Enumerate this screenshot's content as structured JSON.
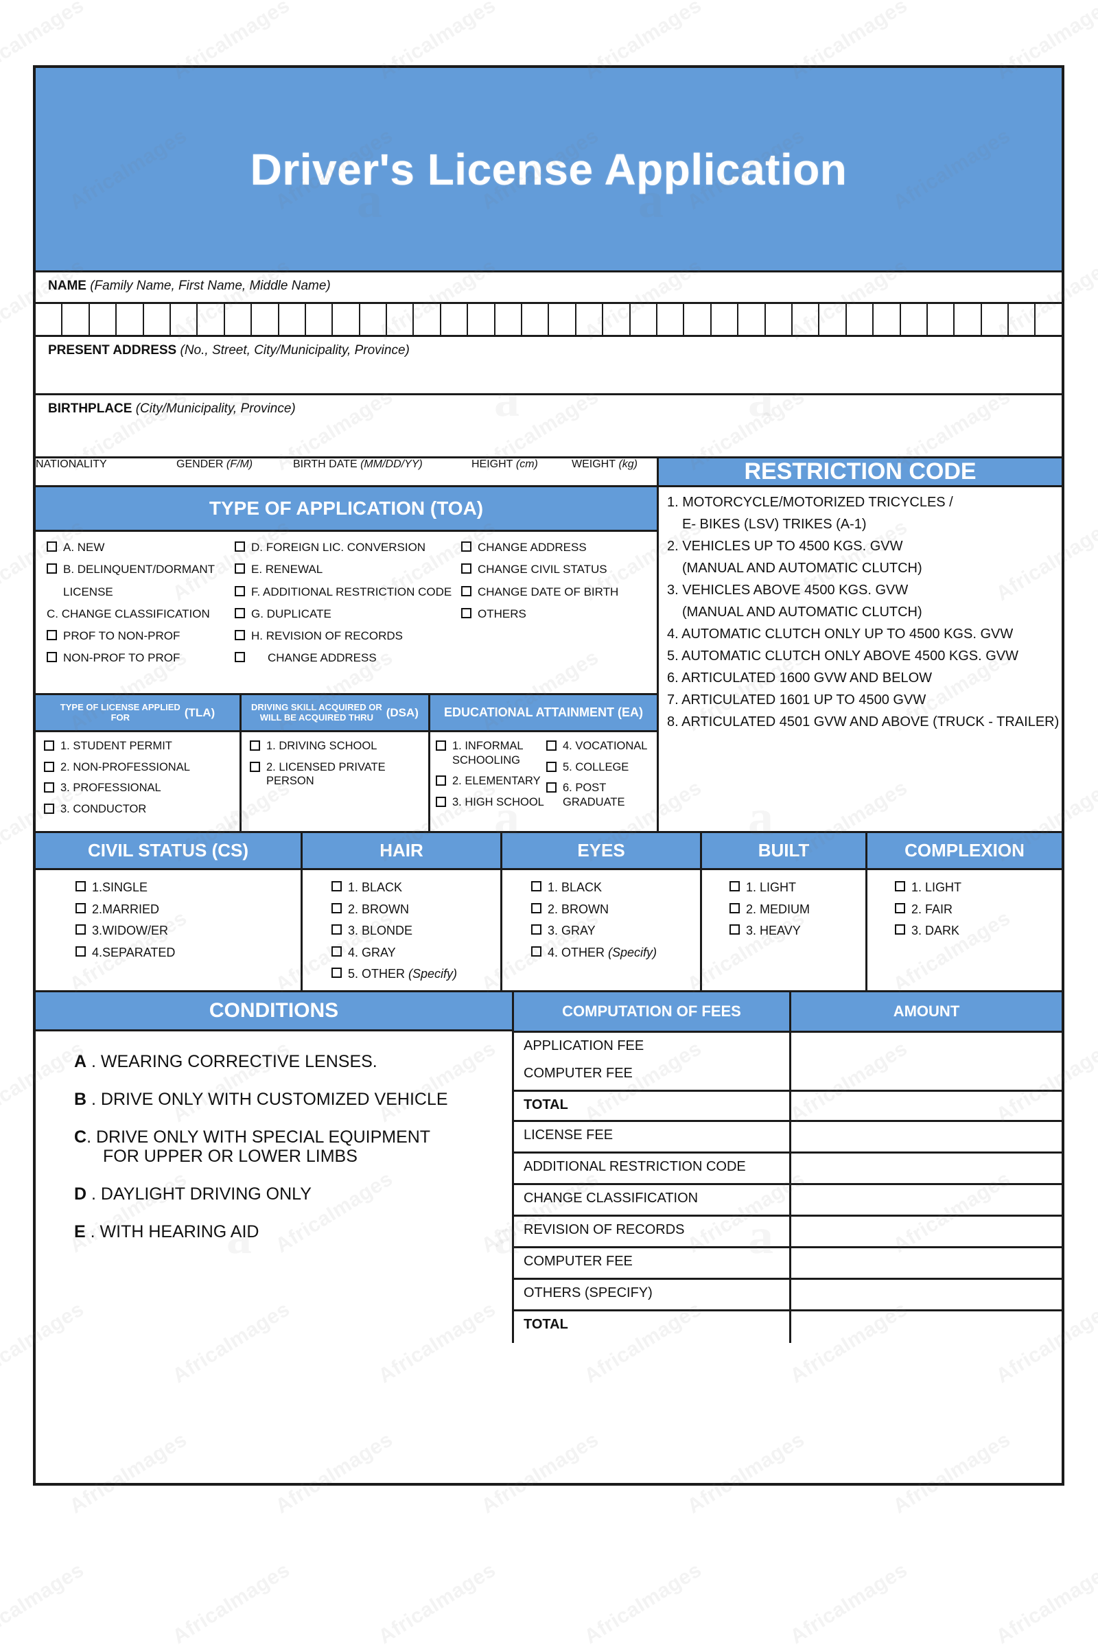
{
  "colors": {
    "accent": "#639CD9",
    "border": "#1b1b1b",
    "header_text": "#ffffff"
  },
  "header": {
    "title": "Driver's License Application"
  },
  "fields": {
    "name_label": "NAME",
    "name_hint": "(Family Name, First Name, Middle Name)",
    "name_cell_count": 38,
    "present_address_label": "PRESENT ADDRESS",
    "present_address_hint": "(No., Street, City/Municipality, Province)",
    "birthplace_label": "BIRTHPLACE",
    "birthplace_hint": "(City/Municipality, Province)"
  },
  "demographics": [
    {
      "label": "NATIONALITY",
      "hint": ""
    },
    {
      "label": "GENDER",
      "hint": "(F/M)"
    },
    {
      "label": "BIRTH DATE",
      "hint": "(MM/DD/YY)"
    },
    {
      "label": "HEIGHT",
      "hint": "(cm)"
    },
    {
      "label": "WEIGHT",
      "hint": "(kg)"
    }
  ],
  "toa": {
    "title": "TYPE OF APPLICATION (TOA)",
    "col1": [
      {
        "label": "A. NEW",
        "box": true,
        "indent": false
      },
      {
        "label": "B. DELINQUENT/DORMANT",
        "box": true,
        "indent": false
      },
      {
        "label": "LICENSE",
        "box": false,
        "indent": true
      },
      {
        "label": "C. CHANGE CLASSIFICATION",
        "box": false,
        "indent": false
      },
      {
        "label": "PROF TO NON-PROF",
        "box": true,
        "indent": false
      },
      {
        "label": "NON-PROF TO PROF",
        "box": true,
        "indent": false
      }
    ],
    "col2": [
      {
        "label": "D. FOREIGN LIC. CONVERSION",
        "box": true,
        "indent": false
      },
      {
        "label": "E. RENEWAL",
        "box": true,
        "indent": false
      },
      {
        "label": "F. ADDITIONAL RESTRICTION CODE",
        "box": true,
        "indent": false
      },
      {
        "label": "G. DUPLICATE",
        "box": true,
        "indent": false
      },
      {
        "label": "H. REVISION OF RECORDS",
        "box": true,
        "indent": false
      },
      {
        "label": "CHANGE ADDRESS",
        "box": true,
        "indent": true
      }
    ],
    "col3": [
      {
        "label": "CHANGE ADDRESS",
        "box": true,
        "indent": false
      },
      {
        "label": "CHANGE CIVIL STATUS",
        "box": true,
        "indent": false
      },
      {
        "label": "CHANGE DATE OF BIRTH",
        "box": true,
        "indent": false
      },
      {
        "label": "OTHERS",
        "box": true,
        "indent": false
      }
    ]
  },
  "tla": {
    "title_line1": "TYPE OF LICENSE APPLIED",
    "title_line2": "FOR",
    "abbr": "(TLA)",
    "options": [
      {
        "label": "1. STUDENT PERMIT"
      },
      {
        "label": "2. NON-PROFESSIONAL"
      },
      {
        "label": "3. PROFESSIONAL"
      },
      {
        "label": "3. CONDUCTOR"
      }
    ]
  },
  "dsa": {
    "title_line1": "DRIVING SKILL ACQUIRED OR",
    "title_line2": "WILL BE ACQUIRED THRU",
    "abbr": "(DSA)",
    "options": [
      {
        "label": "1. DRIVING SCHOOL"
      },
      {
        "label": "2. LICENSED PRIVATE PERSON"
      }
    ]
  },
  "ea": {
    "title": "EDUCATIONAL ATTAINMENT (EA)",
    "col1": [
      {
        "label": "1. INFORMAL SCHOOLING"
      },
      {
        "label": "2. ELEMENTARY"
      },
      {
        "label": "3. HIGH SCHOOL"
      }
    ],
    "col2": [
      {
        "label": "4. VOCATIONAL"
      },
      {
        "label": "5. COLLEGE"
      },
      {
        "label": "6. POST GRADUATE"
      }
    ]
  },
  "restriction_code": {
    "title": "RESTRICTION CODE",
    "lines": [
      {
        "text": "1. MOTORCYCLE/MOTORIZED TRICYCLES /",
        "indent": false
      },
      {
        "text": "E- BIKES (LSV) TRIKES (A-1)",
        "indent": true
      },
      {
        "text": "2.   VEHICLES UP TO 4500 KGS. GVW",
        "indent": false
      },
      {
        "text": "(MANUAL AND AUTOMATIC CLUTCH)",
        "indent": true
      },
      {
        "text": "3.  VEHICLES ABOVE 4500 KGS. GVW",
        "indent": false
      },
      {
        "text": "(MANUAL AND AUTOMATIC CLUTCH)",
        "indent": true
      },
      {
        "text": "4.  AUTOMATIC CLUTCH ONLY UP TO 4500 KGS. GVW",
        "indent": false
      },
      {
        "text": "5.  AUTOMATIC CLUTCH ONLY ABOVE 4500 KGS. GVW",
        "indent": false
      },
      {
        "text": "6.  ARTICULATED 1600 GVW AND BELOW",
        "indent": false
      },
      {
        "text": "7.  ARTICULATED 1601 UP TO 4500 GVW",
        "indent": false
      },
      {
        "text": "8.  ARTICULATED 4501 GVW AND ABOVE (TRUCK - TRAILER)",
        "indent": false
      }
    ]
  },
  "physical": {
    "civil_status": {
      "title": "CIVIL STATUS (CS)",
      "options": [
        "1.SINGLE",
        "2.MARRIED",
        "3.WIDOW/ER",
        "4.SEPARATED"
      ]
    },
    "hair": {
      "title": "HAIR",
      "options": [
        "1. BLACK",
        "2. BROWN",
        "3. BLONDE",
        "4. GRAY",
        "5. OTHER (Specify)"
      ]
    },
    "eyes": {
      "title": "EYES",
      "options": [
        "1. BLACK",
        "2. BROWN",
        "3. GRAY",
        "4. OTHER (Specify)"
      ]
    },
    "built": {
      "title": "BUILT",
      "options": [
        "1. LIGHT",
        "2. MEDIUM",
        "3. HEAVY"
      ]
    },
    "complexion": {
      "title": "COMPLEXION",
      "options": [
        "1. LIGHT",
        "2. FAIR",
        "3. DARK"
      ]
    }
  },
  "conditions": {
    "title": "CONDITIONS",
    "items": [
      {
        "letter": "A",
        "sep": " . ",
        "text": "WEARING CORRECTIVE LENSES.",
        "sub": ""
      },
      {
        "letter": "B",
        "sep": " . ",
        "text": "DRIVE ONLY WITH CUSTOMIZED VEHICLE",
        "sub": ""
      },
      {
        "letter": "C",
        "sep": ". ",
        "text": "DRIVE ONLY WITH SPECIAL EQUIPMENT",
        "sub": "FOR UPPER OR LOWER LIMBS"
      },
      {
        "letter": "D",
        "sep": " . ",
        "text": "DAYLIGHT DRIVING ONLY",
        "sub": ""
      },
      {
        "letter": "E",
        "sep": " . ",
        "text": "WITH HEARING AID",
        "sub": ""
      }
    ]
  },
  "fees": {
    "header_left": "COMPUTATION OF FEES",
    "header_right": "AMOUNT",
    "rows": [
      {
        "label": "APPLICATION FEE",
        "bold": false,
        "divider": false
      },
      {
        "label": "COMPUTER FEE",
        "bold": false,
        "divider": true
      },
      {
        "label": "TOTAL",
        "bold": true,
        "divider": true
      },
      {
        "label": "LICENSE FEE",
        "bold": false,
        "divider": true
      },
      {
        "label": "ADDITIONAL RESTRICTION CODE",
        "bold": false,
        "divider": true
      },
      {
        "label": "CHANGE CLASSIFICATION",
        "bold": false,
        "divider": true
      },
      {
        "label": "REVISION OF RECORDS",
        "bold": false,
        "divider": true
      },
      {
        "label": "COMPUTER FEE",
        "bold": false,
        "divider": true
      },
      {
        "label": "OTHERS (SPECIFY)",
        "bold": false,
        "divider": true
      },
      {
        "label": "TOTAL",
        "bold": true,
        "divider": false
      }
    ]
  },
  "watermark": {
    "text": "AfricaImages",
    "glyph": "a"
  }
}
